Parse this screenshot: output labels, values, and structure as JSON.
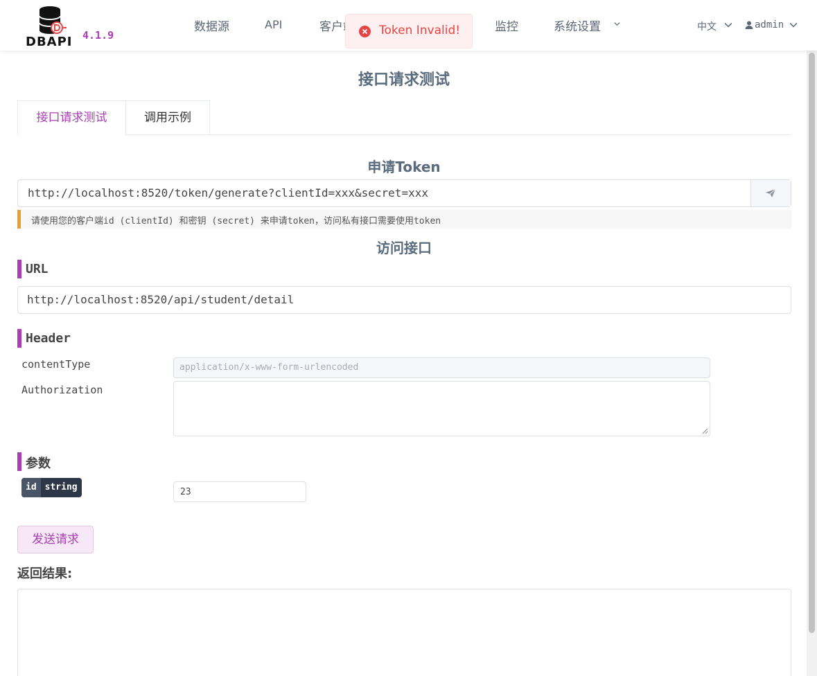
{
  "header": {
    "logo_text": "DBAPI",
    "version": "4.1.9",
    "nav": [
      "数据源",
      "API",
      "客户端",
      "监控",
      "系统设置"
    ],
    "lang": "中文",
    "user": "admin"
  },
  "toast": {
    "message": "Token Invalid!",
    "type": "error"
  },
  "page": {
    "title": "接口请求测试"
  },
  "tabs": [
    "接口请求测试",
    "调用示例"
  ],
  "token_section": {
    "title": "申请Token",
    "url": "http://localhost:8520/token/generate?clientId=xxx&secret=xxx",
    "tip": "请使用您的客户端id (clientId) 和密钥 (secret) 来申请token，访问私有接口需要使用token"
  },
  "access_section": {
    "title": "访问接口",
    "url_label": "URL",
    "url": "http://localhost:8520/api/student/detail",
    "header_label": "Header",
    "headers": [
      {
        "key": "contentType",
        "value": "application/x-www-form-urlencoded"
      },
      {
        "key": "Authorization",
        "value": ""
      }
    ],
    "params_label": "参数",
    "params": [
      {
        "name": "id",
        "type": "string",
        "value": "23"
      }
    ],
    "send_button": "发送请求",
    "result_label": "返回结果:"
  },
  "colors": {
    "accent": "#a93fb2",
    "error": "#e64545",
    "tip_border": "#f0a020"
  },
  "icons": [
    "dbapi-logo-icon",
    "chevron-down-icon",
    "user-icon",
    "error-circle-icon",
    "send-icon"
  ]
}
